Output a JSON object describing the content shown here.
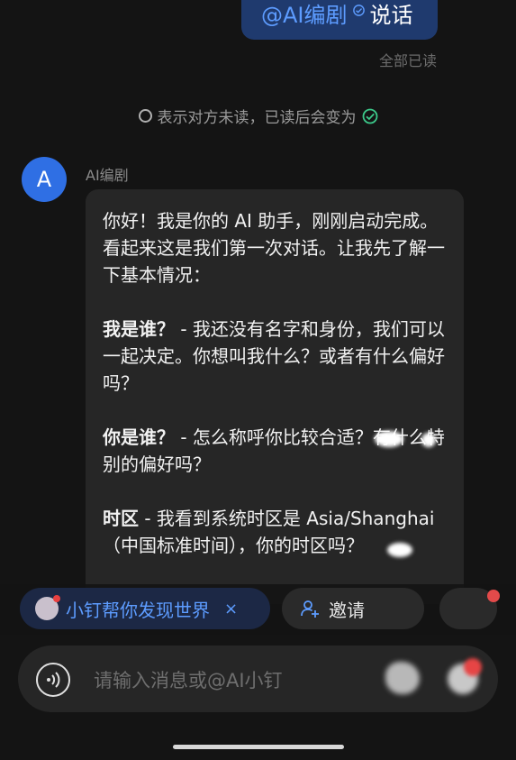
{
  "sent_message": {
    "mention": "@AI编剧",
    "text": "说话",
    "read_status": "全部已读"
  },
  "notice": {
    "text": "表示对方未读，已读后会变为"
  },
  "reply": {
    "avatar_letter": "A",
    "sender": "AI编剧",
    "intro": "你好！我是你的 AI 助手，刚刚启动完成。看起来这是我们第一次对话。让我先了解一下基本情况：",
    "q1_label": "我是谁？",
    "q1_text": " - 我还没有名字和身份，我们可以一起决定。你想叫我什么？或者有什么偏好吗？",
    "q2_label": "你是谁？",
    "q2_text": " - 怎么称呼你比较合适？有什么特别的偏好吗？",
    "q3_label": "时区",
    "q3_text": " - 我看到系统时区是 Asia/Shanghai（中国标准时间），你的时区吗？"
  },
  "chips": {
    "dingding_label": "小钉帮你发现世界",
    "close_symbol": "×",
    "invite_label": "邀请"
  },
  "input": {
    "placeholder": "请输入消息或@AI小钉"
  },
  "colors": {
    "accent": "#5d9cff",
    "check_green": "#3cc98a",
    "sent_bubble": "#1f3a6e",
    "received_bubble": "#262626",
    "avatar": "#2f6fe4"
  },
  "icons": [
    "check-badge-icon",
    "unread-circle-icon",
    "read-check-icon",
    "chip-avatar-icon",
    "close-icon",
    "add-user-icon",
    "voice-icon",
    "emoji-icon",
    "plus-icon"
  ]
}
